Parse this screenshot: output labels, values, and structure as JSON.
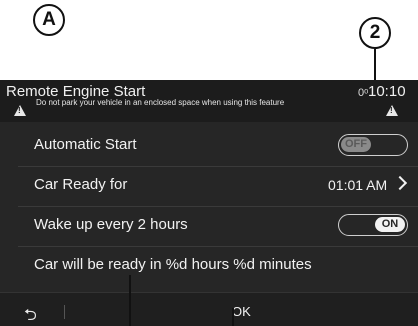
{
  "callouts": {
    "a": "A",
    "two": "2"
  },
  "header": {
    "title": "Remote Engine Start",
    "signal": "0ᵒ",
    "clock": "10:10",
    "warning": "Do not park your vehicle in an enclosed space when using this feature"
  },
  "settings": {
    "automatic_start": {
      "label": "Automatic Start",
      "state": "OFF"
    },
    "car_ready_for": {
      "label": "Car Ready for",
      "value": "01:01 AM"
    },
    "wake_up": {
      "label": "Wake up every 2 hours",
      "state": "ON"
    },
    "status": "Car will be ready in %d hours %d minutes"
  },
  "footer": {
    "back": "⮌",
    "ok": "OK"
  }
}
